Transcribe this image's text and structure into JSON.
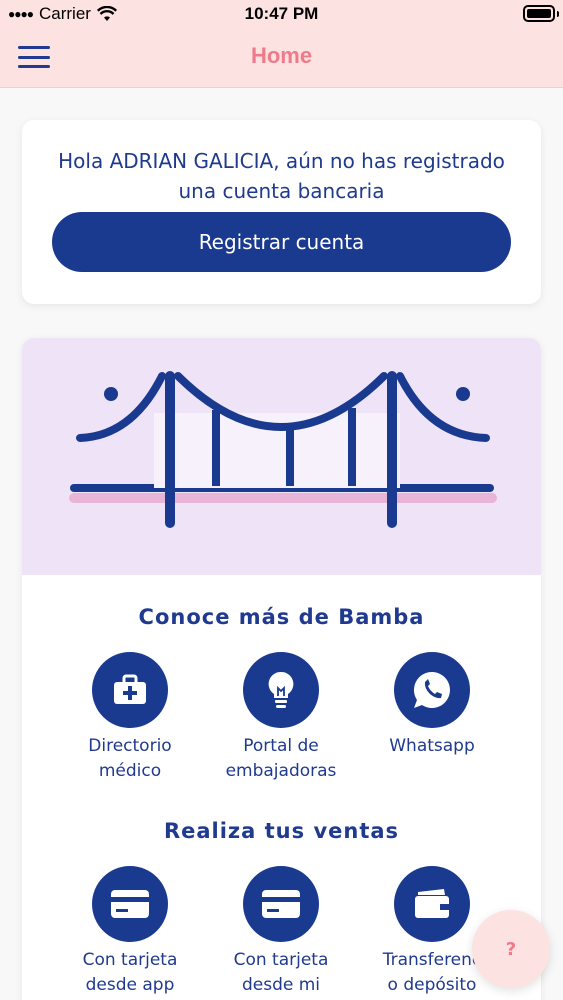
{
  "status_bar": {
    "carrier": "Carrier",
    "time": "10:47 PM"
  },
  "nav": {
    "title": "Home"
  },
  "account_card": {
    "greeting_prefix": "Hola",
    "user_name": "ADRIAN GALICIA",
    "greeting_suffix": ", aún no has registrado una cuenta bancaria",
    "register_button": "Registrar cuenta"
  },
  "info_section": {
    "title": "Conoce más de Bamba",
    "tiles": [
      {
        "label_line1": "Directorio",
        "label_line2": "médico",
        "icon": "medical-kit-icon"
      },
      {
        "label_line1": "Portal de",
        "label_line2": "embajadoras",
        "icon": "lightbulb-icon"
      },
      {
        "label_line1": "Whatsapp",
        "label_line2": "",
        "icon": "whatsapp-icon"
      }
    ]
  },
  "sales_section": {
    "title": "Realiza tus ventas",
    "tiles": [
      {
        "label_line1": "Con tarjeta",
        "label_line2": "desde app",
        "icon": "credit-card-icon"
      },
      {
        "label_line1": "Con tarjeta",
        "label_line2": "desde mi",
        "icon": "credit-card-icon"
      },
      {
        "label_line1": "Transferenc",
        "label_line2": "o depósito",
        "icon": "wallet-icon"
      }
    ]
  },
  "help_button": {
    "label": "?"
  },
  "colors": {
    "primary": "#1a3a90",
    "accent": "#f07a8a",
    "header_bg": "#fde2e2",
    "banner_bg": "#efe3f7"
  }
}
